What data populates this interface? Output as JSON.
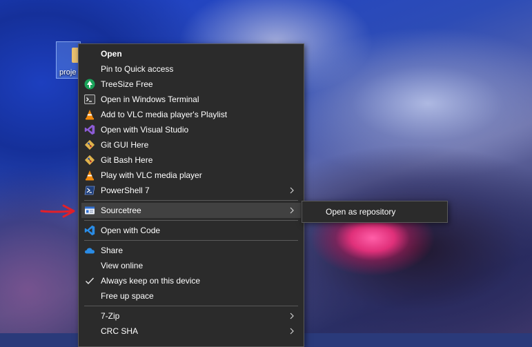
{
  "desktop": {
    "folder_label": "proje"
  },
  "menu": {
    "items": [
      {
        "label": "Open",
        "icon": "none"
      },
      {
        "label": "Pin to Quick access",
        "icon": "none"
      },
      {
        "label": "TreeSize Free",
        "icon": "treesize-icon"
      },
      {
        "label": "Open in Windows Terminal",
        "icon": "terminal-icon"
      },
      {
        "label": "Add to VLC media player's Playlist",
        "icon": "vlc-icon"
      },
      {
        "label": "Open with Visual Studio",
        "icon": "visual-studio-icon"
      },
      {
        "label": "Git GUI Here",
        "icon": "git-icon"
      },
      {
        "label": "Git Bash Here",
        "icon": "git-icon"
      },
      {
        "label": "Play with VLC media player",
        "icon": "vlc-icon"
      },
      {
        "label": "PowerShell 7",
        "icon": "powershell-icon"
      },
      {
        "label": "Sourcetree",
        "icon": "sourcetree-icon"
      },
      {
        "label": "Open with Code",
        "icon": "vscode-icon"
      },
      {
        "label": "Share",
        "icon": "onedrive-cloud-icon"
      },
      {
        "label": "View online",
        "icon": "none"
      },
      {
        "label": "Always keep on this device",
        "icon": "checkmark-icon"
      },
      {
        "label": "Free up space",
        "icon": "none"
      },
      {
        "label": "7-Zip",
        "icon": "none"
      },
      {
        "label": "CRC SHA",
        "icon": "none"
      }
    ]
  },
  "submenu": {
    "items": [
      {
        "label": "Open as repository"
      }
    ]
  },
  "colors": {
    "menu_bg": "#2b2b2b",
    "highlight": "#414141",
    "arrow": "#e0202a"
  }
}
